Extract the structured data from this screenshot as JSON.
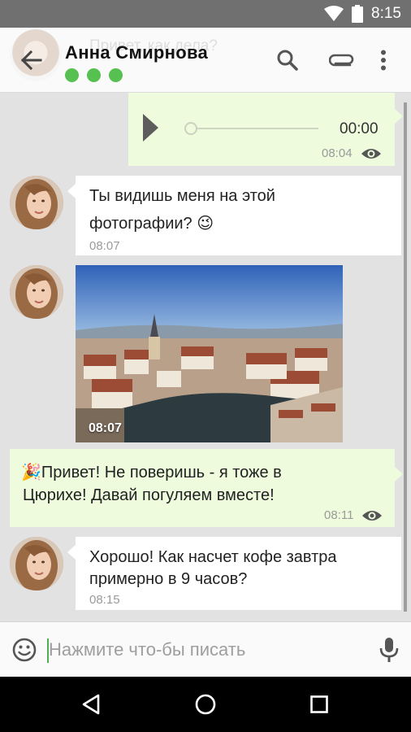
{
  "status_bar": {
    "time": "8:15",
    "icons": [
      "wifi-icon",
      "battery-icon"
    ]
  },
  "header": {
    "ghost_text": "Привет, как дела?",
    "contact_name": "Анна Смирнова",
    "presence_dots": 3,
    "icons": [
      "back-arrow-icon",
      "search-icon",
      "paperclip-icon",
      "more-vert-icon"
    ]
  },
  "messages": [
    {
      "type": "audio",
      "direction": "out",
      "duration": "00:00",
      "time": "08:04",
      "seen": true
    },
    {
      "type": "text",
      "direction": "in",
      "line1": "Ты видишь меня на этой",
      "line2": "фотографии?",
      "emoji": "😉",
      "time": "08:07"
    },
    {
      "type": "image",
      "direction": "in",
      "time": "08:07"
    },
    {
      "type": "text",
      "direction": "out",
      "emoji": "🎉",
      "line1": "Привет! Не поверишь - я тоже в",
      "line2": "Цюрихе! Давай погуляем вместе!",
      "time": "08:11",
      "seen": true
    },
    {
      "type": "text",
      "direction": "in",
      "line1": "Хорошо! Как насчет кофе завтра",
      "line2": "примерно в 9 часов?",
      "time": "08:15"
    }
  ],
  "input": {
    "placeholder": "Нажмите что-бы писать",
    "value": ""
  },
  "colors": {
    "outgoing": "#eefbdd",
    "incoming": "#ffffff",
    "presence": "#56c050",
    "background": "#e2e2e2"
  }
}
